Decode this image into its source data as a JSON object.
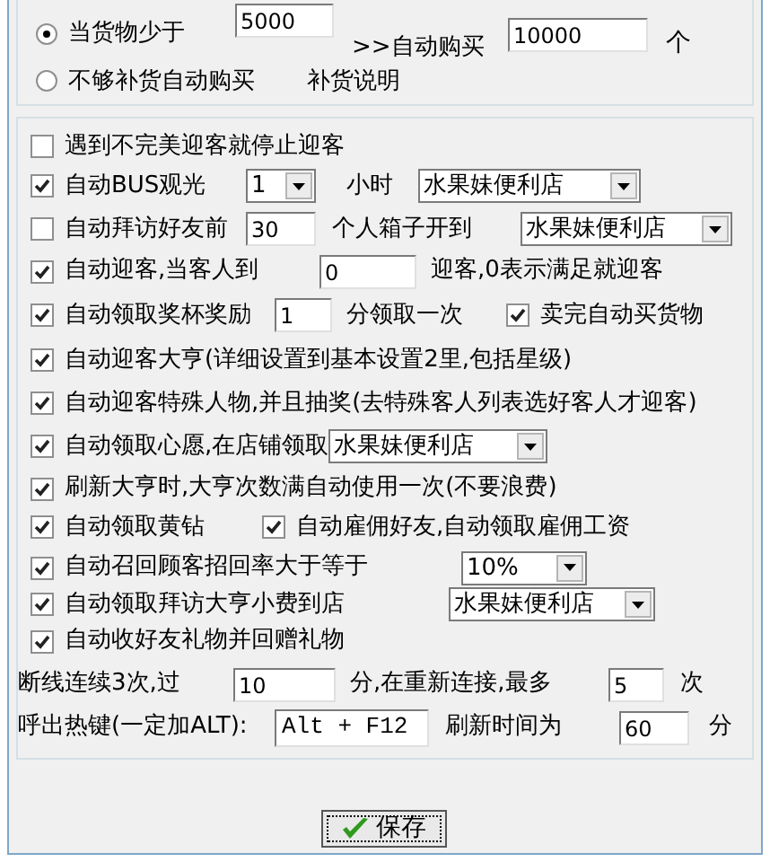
{
  "purchase": {
    "options": [
      {
        "label": "当货物少于",
        "selected": true
      },
      {
        "label": "不够补货自动购买",
        "selected": false
      }
    ],
    "threshold": "5000",
    "buy_label": ">>自动购买",
    "buy_amount": "10000",
    "unit": "个",
    "help_link": "补货说明"
  },
  "settings": [
    {
      "items": [
        {
          "kind": "checkbox",
          "label": "遇到不完美迎客就停止迎客",
          "checked": false
        }
      ]
    },
    {
      "items": [
        {
          "kind": "checkbox",
          "label": "自动BUS观光",
          "checked": true
        },
        {
          "kind": "dropdown",
          "value": "1"
        },
        {
          "kind": "text",
          "text": "小时"
        },
        {
          "kind": "dropdown",
          "value": "水果妹便利店"
        }
      ]
    },
    {
      "items": [
        {
          "kind": "checkbox",
          "label": "自动拜访好友前",
          "checked": false
        },
        {
          "kind": "field",
          "value": "30"
        },
        {
          "kind": "text",
          "text": "个人箱子开到"
        },
        {
          "kind": "dropdown",
          "value": "水果妹便利店"
        }
      ]
    },
    {
      "items": [
        {
          "kind": "checkbox",
          "label": "自动迎客,当客人到",
          "checked": true
        },
        {
          "kind": "field",
          "value": "0"
        },
        {
          "kind": "text",
          "text": "迎客,0表示满足就迎客"
        }
      ]
    },
    {
      "items": [
        {
          "kind": "checkbox",
          "label": "自动领取奖杯奖励",
          "checked": true
        },
        {
          "kind": "field",
          "value": "1"
        },
        {
          "kind": "text",
          "text": "分领取一次"
        },
        {
          "kind": "checkbox",
          "label": "卖完自动买货物",
          "checked": true
        }
      ]
    },
    {
      "items": [
        {
          "kind": "checkbox",
          "label": "自动迎客大亨(详细设置到基本设置2里,包括星级)",
          "checked": true
        }
      ]
    },
    {
      "items": [
        {
          "kind": "checkbox",
          "label": "自动迎客特殊人物,并且抽奖(去特殊客人列表选好客人才迎客)",
          "checked": true
        }
      ]
    },
    {
      "items": [
        {
          "kind": "checkbox",
          "label": "自动领取心愿,在店铺领取",
          "checked": true
        },
        {
          "kind": "dropdown",
          "value": "水果妹便利店"
        }
      ]
    },
    {
      "items": [
        {
          "kind": "checkbox",
          "label": "刷新大亨时,大亨次数满自动使用一次(不要浪费)",
          "checked": true
        }
      ]
    },
    {
      "items": [
        {
          "kind": "checkbox",
          "label": "自动领取黄钻",
          "checked": true
        },
        {
          "kind": "checkbox",
          "label": "自动雇佣好友,自动领取雇佣工资",
          "checked": true
        }
      ]
    },
    {
      "items": [
        {
          "kind": "checkbox",
          "label": "自动召回顾客招回率大于等于",
          "checked": true
        },
        {
          "kind": "dropdown",
          "value": "10%"
        }
      ]
    },
    {
      "items": [
        {
          "kind": "checkbox",
          "label": "自动领取拜访大亨小费到店",
          "checked": true
        },
        {
          "kind": "dropdown",
          "value": "水果妹便利店"
        }
      ]
    },
    {
      "items": [
        {
          "kind": "checkbox",
          "label": "自动收好友礼物并回赠礼物",
          "checked": true
        }
      ]
    },
    {
      "items": [
        {
          "kind": "text",
          "text": "断线连续3次,过"
        },
        {
          "kind": "field",
          "value": "10"
        },
        {
          "kind": "text",
          "text": "分,在重新连接,最多"
        },
        {
          "kind": "field",
          "value": "5"
        },
        {
          "kind": "text",
          "text": "次"
        }
      ]
    },
    {
      "items": [
        {
          "kind": "text",
          "text": "呼出热键(一定加ALT):"
        },
        {
          "kind": "hotkey",
          "value": "Alt + F12"
        },
        {
          "kind": "text",
          "text": "刷新时间为"
        },
        {
          "kind": "field",
          "value": "60"
        },
        {
          "kind": "text",
          "text": "分"
        }
      ]
    }
  ],
  "save_button": "保存"
}
